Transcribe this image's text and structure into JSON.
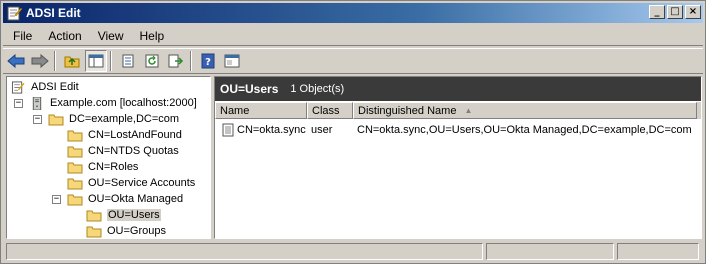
{
  "window": {
    "title": "ADSI Edit"
  },
  "menu": [
    "File",
    "Action",
    "View",
    "Help"
  ],
  "tree": {
    "root": "ADSI Edit",
    "connection": "Example.com [localhost:2000]",
    "domain": "DC=example,DC=com",
    "containers": [
      "CN=LostAndFound",
      "CN=NTDS Quotas",
      "CN=Roles",
      "OU=Service Accounts",
      "OU=Okta Managed"
    ],
    "okta_children": [
      "OU=Users",
      "OU=Groups"
    ],
    "selected": "OU=Users"
  },
  "details": {
    "header_title": "OU=Users",
    "header_count": "1 Object(s)",
    "columns": [
      "Name",
      "Class",
      "Distinguished Name"
    ],
    "sort_indicator": "▲",
    "rows": [
      {
        "name": "CN=okta.sync",
        "class": "user",
        "dn": "CN=okta.sync,OU=Users,OU=Okta Managed,DC=example,DC=com"
      }
    ]
  },
  "icons": [
    "app-icon",
    "back-icon",
    "forward-icon",
    "up-folder-icon",
    "show-tree-icon",
    "properties-icon",
    "refresh-icon",
    "export-icon",
    "help-icon",
    "console-icon"
  ]
}
